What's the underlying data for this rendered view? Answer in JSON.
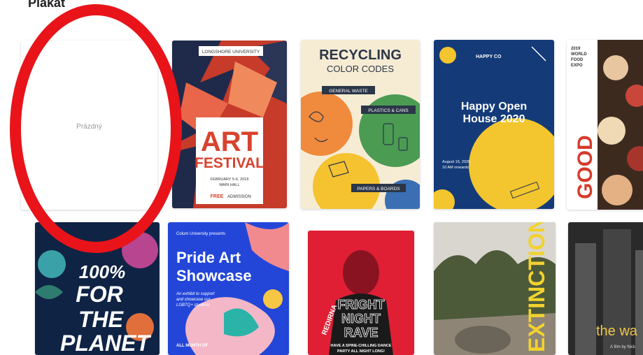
{
  "section": {
    "title": "Plakát"
  },
  "blank": {
    "label": "Prázdný"
  },
  "art_festival": {
    "university": "LONGSHORE UNIVERSITY",
    "title1": "ART",
    "title2": "FESTIVAL",
    "date": "FEBRUARY 5-6, 2018",
    "venue": "MAIN HALL",
    "free": "FREE",
    "admission": "ADMISSION"
  },
  "recycling": {
    "title": "RECYCLING",
    "subtitle": "COLOR CODES",
    "tag1": "GENERAL WASTE",
    "tag2": "PLASTICS & CANS",
    "tag3": "PAPERS & BOARDS"
  },
  "open_house": {
    "brand": "HAPPY CO",
    "title1": "Happy Open",
    "title2": "House 2020",
    "date": "August 16, 2020",
    "time": "10 AM onwards"
  },
  "food_expo": {
    "line1": "2019",
    "line2": "WORLD",
    "line3": "FOOD",
    "line4": "EXPO",
    "word": "GOOD"
  },
  "planet": {
    "line1": "100%",
    "line2": "FOR",
    "line3": "THE",
    "line4": "PLANET"
  },
  "pride": {
    "presenter": "Colum University presents",
    "title1": "Pride Art",
    "title2": "Showcase",
    "desc1": "An exhibit to support",
    "desc2": "and showcase our",
    "desc3": "LGBTQ+ students",
    "footer": "ALL MONTH OF"
  },
  "fright": {
    "line1": "FRIGHT",
    "line2": "NIGHT",
    "line3": "RAVE",
    "side": "REDIRNA",
    "footer1": "HAVE A SPINE-CHILLING DANCE",
    "footer2": "PARTY ALL NIGHT LONG!"
  },
  "extinction": {
    "word": "EXTINCTION"
  },
  "the_wall": {
    "title": "the wa",
    "credit": "A film by Nick"
  },
  "colors": {
    "annotation": "#e8141a"
  }
}
